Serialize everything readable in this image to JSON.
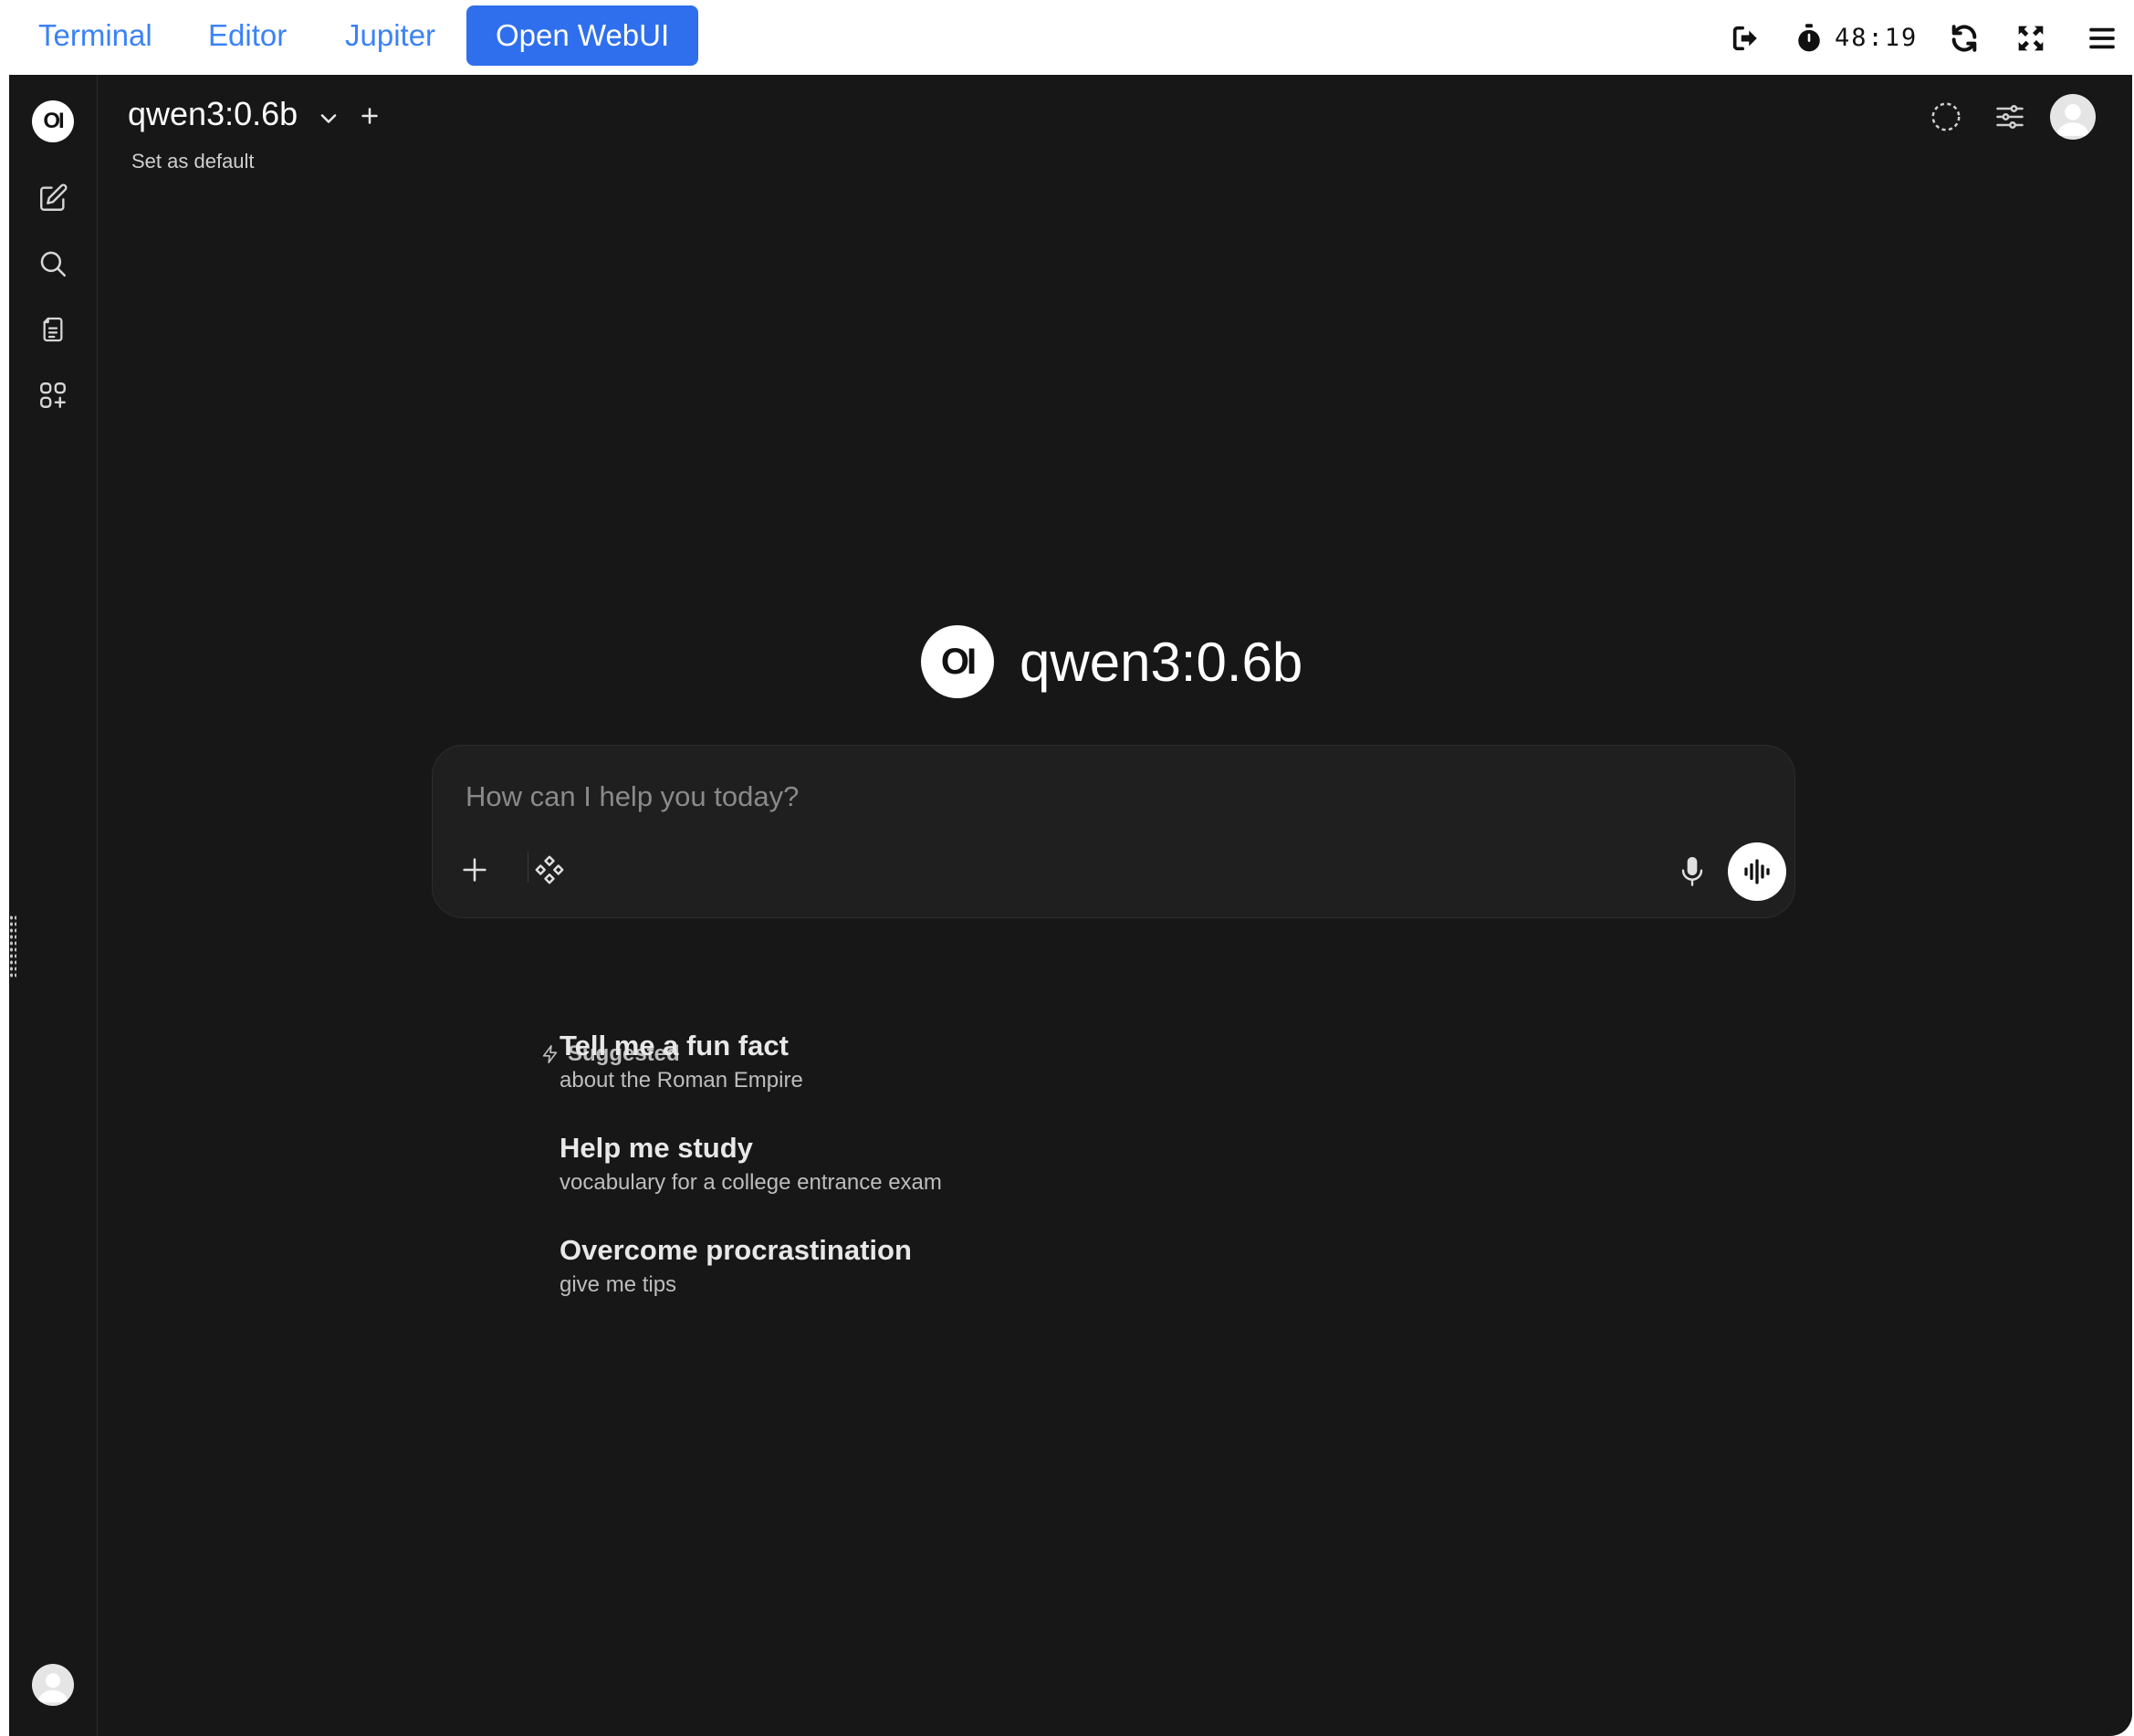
{
  "topbar": {
    "tabs": [
      {
        "label": "Terminal"
      },
      {
        "label": "Editor"
      },
      {
        "label": "Jupiter"
      },
      {
        "label": "Open WebUI"
      }
    ],
    "active_tab": "Open WebUI",
    "timer": "48:19",
    "icons": [
      "sign-out-icon",
      "stopwatch-icon",
      "refresh-icon",
      "fullscreen-icon",
      "menu-icon"
    ]
  },
  "sidebar": {
    "logo_text": "OI",
    "icons": [
      "new-chat-icon",
      "search-icon",
      "notes-icon",
      "workspace-icon",
      "user-avatar"
    ]
  },
  "header": {
    "model_name": "qwen3:0.6b",
    "set_default": "Set as default",
    "icons": [
      "temporary-chat-icon",
      "controls-icon",
      "user-avatar"
    ]
  },
  "main": {
    "logo_text": "OI",
    "title": "qwen3:0.6b",
    "input_placeholder": "How can I help you today?",
    "suggested_label": "Suggested",
    "suggestions": [
      {
        "title": "Tell me a fun fact",
        "subtitle": "about the Roman Empire"
      },
      {
        "title": "Help me study",
        "subtitle": "vocabulary for a college entrance exam"
      },
      {
        "title": "Overcome procrastination",
        "subtitle": "give me tips"
      }
    ]
  },
  "colors": {
    "accent_blue": "#3b82f6",
    "active_tab_bg": "#2f6fed",
    "app_bg": "#171717",
    "chatbox_bg": "#1f1f1f"
  }
}
